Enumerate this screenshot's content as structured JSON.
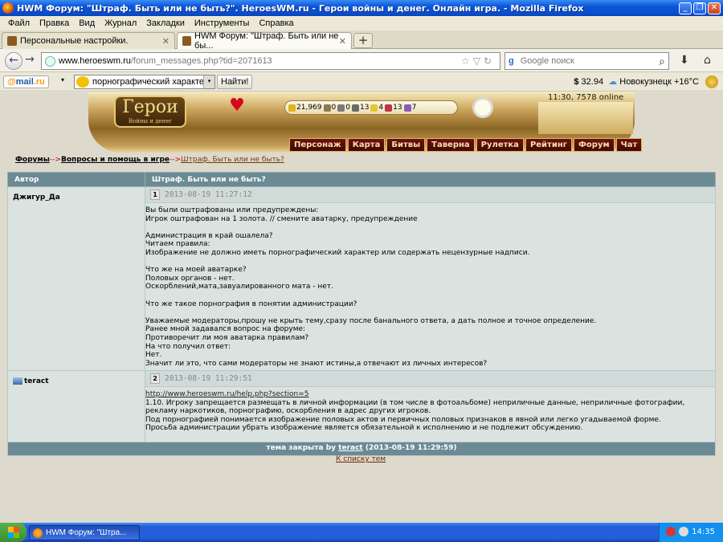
{
  "window": {
    "title": "HWM Форум: \"Штраф. Быть или не быть?\". HeroesWM.ru - Герои войны и денег. Онлайн игра. - Mozilla Firefox",
    "min": "_",
    "max": "❐",
    "close": "✕"
  },
  "menu": [
    "Файл",
    "Правка",
    "Вид",
    "Журнал",
    "Закладки",
    "Инструменты",
    "Справка"
  ],
  "tabs": [
    {
      "label": "Персональные настройки.",
      "close": "✕"
    },
    {
      "label": "HWM Форум: \"Штраф. Быть или не бы...",
      "close": "✕"
    }
  ],
  "newtab": "+",
  "nav": {
    "back": "←",
    "forward": "→",
    "url_host": "www.heroeswm.ru",
    "url_rest": "/forum_messages.php?tid=2071613",
    "url_icons": "☆▽↻",
    "search_engine": "g",
    "search_placeholder": "Google поиск",
    "download": "⬇",
    "home": "⌂"
  },
  "mailbar": {
    "logo_at": "@",
    "logo_mail": "mail",
    "logo_ru": ".ru",
    "dropdown": "▾",
    "search_value": "порнографический характер",
    "search_btn": "Найти!",
    "currency": "$",
    "rate": "32.94",
    "weather": "Новокузнецк +16°C"
  },
  "game": {
    "logo": "Герои",
    "logo_sub": "Войны и денег",
    "heart": "♥",
    "resources": [
      {
        "value": "21,969",
        "color": "#e4b21c"
      },
      {
        "value": "0",
        "color": "#8a7a52"
      },
      {
        "value": "0",
        "color": "#7a7a7a"
      },
      {
        "value": "13",
        "color": "#6a6a6a"
      },
      {
        "value": "4",
        "color": "#e5c830"
      },
      {
        "value": "13",
        "color": "#c2324a"
      },
      {
        "value": "7",
        "color": "#8a5ab8"
      }
    ],
    "server_time": "11:30, 7578 online",
    "menu": [
      "Персонаж",
      "Карта",
      "Битвы",
      "Таверна",
      "Рулетка",
      "Рейтинг",
      "Форум",
      "Чат"
    ]
  },
  "breadcrumbs": {
    "forums": "Форумы",
    "sep": "-->",
    "section": "Вопросы и помощь в игре",
    "current": "Штраф. Быть или не быть?"
  },
  "table": {
    "col_author": "Автор",
    "col_topic": "Штраф. Быть или не быть?",
    "posts": [
      {
        "author": "Джигур_Да",
        "num": "1",
        "date": "2013-08-19 11:27:12",
        "body": "Вы были оштрафованы или предупреждены:\nИгрок оштрафован на 1 золота. // смените аватарку, предупреждение\n\nАдминистрация в край ошалела?\nЧитаем правила:\nИзображение не должно иметь порнографический характер или содержать нецензурные надписи.\n\nЧто же на моей аватарке?\nПоловых органов - нет.\nОскорблений,мата,завуалированного мата - нет.\n\nЧто же такое порнография в понятии администрации?\n\nУважаемые модераторы,прошу не крыть тему,сразу после банального ответа, а дать полное и точное определение.\nРанее мной задавался вопрос на форуме:\nПротиворечит ли моя аватарка правилам?\nНа что получил ответ:\nНет.\nЗначит ли это, что сами модераторы не знают истины,а отвечают из личных интересов?"
      },
      {
        "author": "teract",
        "num": "2",
        "date": "2013-08-19 11:29:51",
        "link": "http://www.heroeswm.ru/help.php?section=5",
        "body": "1.10. Игроку запрещается размещать в личной информации (в том числе в фотоальбоме) неприличные данные, неприличные фотографии, рекламу наркотиков, порнографию, оскорбления в адрес других игроков.\nПод порнографией понимается изображение половых актов и первичных половых признаков в явной или легко угадываемой форме.\nПросьба администрации убрать изображение является обязательной к исполнению и не подлежит обсуждению."
      }
    ],
    "closed_prefix": "тема закрыта by",
    "closed_by": "teract",
    "closed_date": "(2013-08-19 11:29:59)"
  },
  "backlink": "К списку тем",
  "taskbar": {
    "item": "HWM Форум: \"Штра...",
    "time": "14:35"
  }
}
